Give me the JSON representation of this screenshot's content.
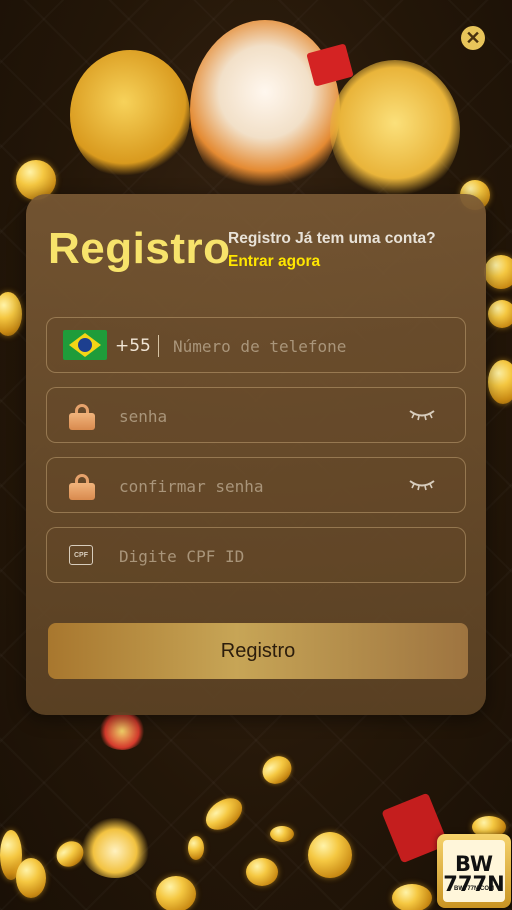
{
  "header": {
    "close_icon": "close-icon"
  },
  "form": {
    "title": "Registro",
    "subtitle": "Registro Já tem uma conta?",
    "login_link": "Entrar agora",
    "phone": {
      "country_code": "+55",
      "placeholder": "Número de telefone",
      "flag": "brazil-flag-icon"
    },
    "password": {
      "placeholder": "senha",
      "icon": "lock-icon",
      "toggle_icon": "eye-closed-icon"
    },
    "confirm_password": {
      "placeholder": "confirmar senha",
      "icon": "lock-icon",
      "toggle_icon": "eye-closed-icon"
    },
    "cpf": {
      "placeholder": "Digite CPF ID",
      "icon_text": "CPF"
    },
    "submit_label": "Registro"
  },
  "brand": {
    "logo_main": "BW 777N",
    "logo_domain": "BW777N.COM"
  },
  "colors": {
    "title": "#f7e36b",
    "link": "#ffe600",
    "button_gold": "#c7a556",
    "card": "#785834"
  }
}
